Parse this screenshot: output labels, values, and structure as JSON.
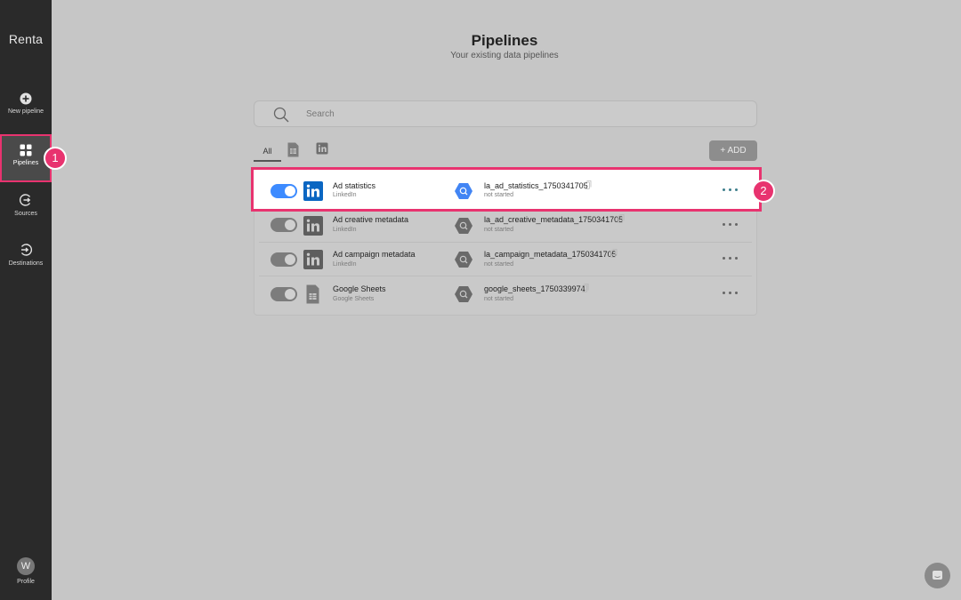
{
  "app": {
    "brand": "Renta"
  },
  "sidebar": {
    "items": [
      {
        "label": "New pipeline"
      },
      {
        "label": "Pipelines"
      },
      {
        "label": "Sources"
      },
      {
        "label": "Destinations"
      }
    ],
    "profile": {
      "initial": "W",
      "label": "Profile"
    }
  },
  "header": {
    "title": "Pipelines",
    "subtitle": "Your existing data pipelines"
  },
  "search": {
    "placeholder": "Search",
    "value": ""
  },
  "tabs": {
    "all": "All"
  },
  "add_button": "+ ADD",
  "badges": {
    "first": "1",
    "second": "2"
  },
  "pipelines": [
    {
      "source": "Ad statistics",
      "source_type": "LinkedIn",
      "destination": "la_ad_statistics_1750341705",
      "status": "not started",
      "enabled": true
    },
    {
      "source": "Ad creative metadata",
      "source_type": "LinkedIn",
      "destination": "la_ad_creative_metadata_1750341705",
      "status": "not started",
      "enabled": true
    },
    {
      "source": "Ad campaign metadata",
      "source_type": "LinkedIn",
      "destination": "la_campaign_metadata_1750341705",
      "status": "not started",
      "enabled": true
    },
    {
      "source": "Google Sheets",
      "source_type": "Google Sheets",
      "destination": "google_sheets_1750339974",
      "status": "not started",
      "enabled": true
    }
  ],
  "colors": {
    "accent": "#3d8bff",
    "highlight": "#e8336f",
    "sidebar": "#2a2a2a"
  }
}
